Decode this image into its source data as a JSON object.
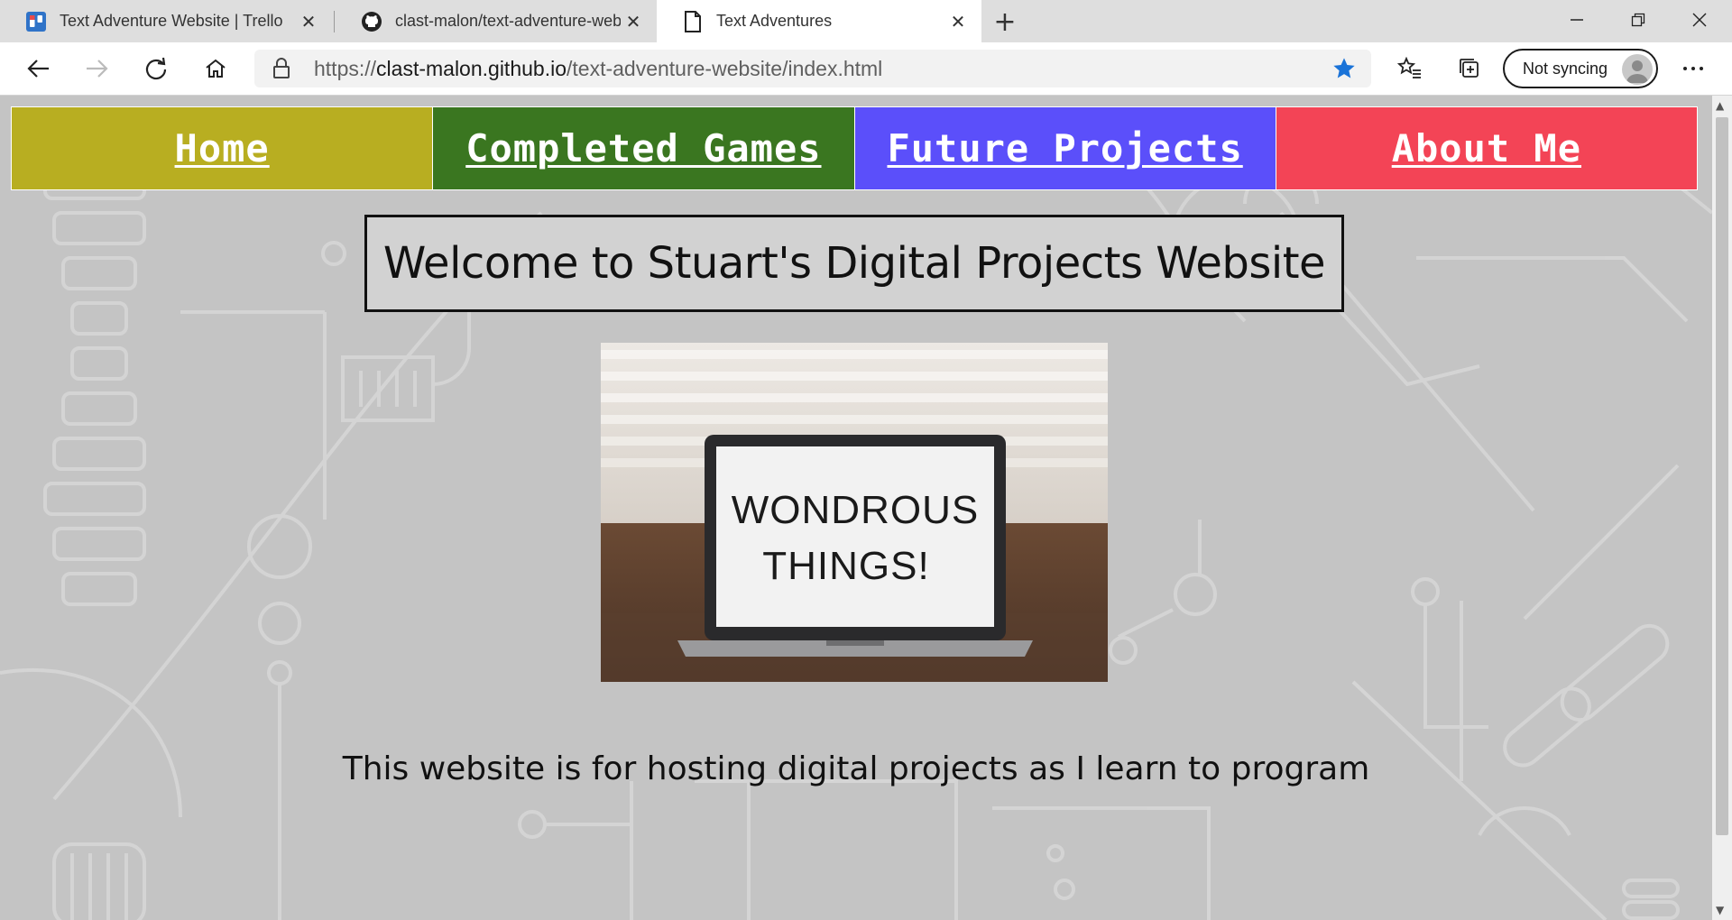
{
  "browser": {
    "tabs": [
      {
        "title": "Text Adventure Website | Trello",
        "icon": "trello-icon",
        "active": false
      },
      {
        "title": "clast-malon/text-adventure-website",
        "icon": "github-icon",
        "active": false
      },
      {
        "title": "Text Adventures",
        "icon": "page-icon",
        "active": true
      }
    ],
    "url_prefix": "https://",
    "url_host": "clast-malon.github.io",
    "url_path": "/text-adventure-website/index.html",
    "sync_label": "Not syncing",
    "bookmarked": true
  },
  "page": {
    "nav": [
      {
        "label": "Home",
        "color": "#b8ae21"
      },
      {
        "label": "Completed Games",
        "color": "#3a7620"
      },
      {
        "label": "Future Projects",
        "color": "#5b4ffa"
      },
      {
        "label": "About Me",
        "color": "#f34456"
      }
    ],
    "welcome_title": "Welcome to Stuart's Digital Projects Website",
    "hero_image": {
      "line1": "WONDROUS",
      "line2": "THINGS!"
    },
    "tagline": "This website is for hosting digital projects as I learn to program"
  },
  "colors": {
    "page_background": "#c4c4c4",
    "circuit_lines": "#d9d9d9",
    "accent_blue": "#1a73d8"
  }
}
